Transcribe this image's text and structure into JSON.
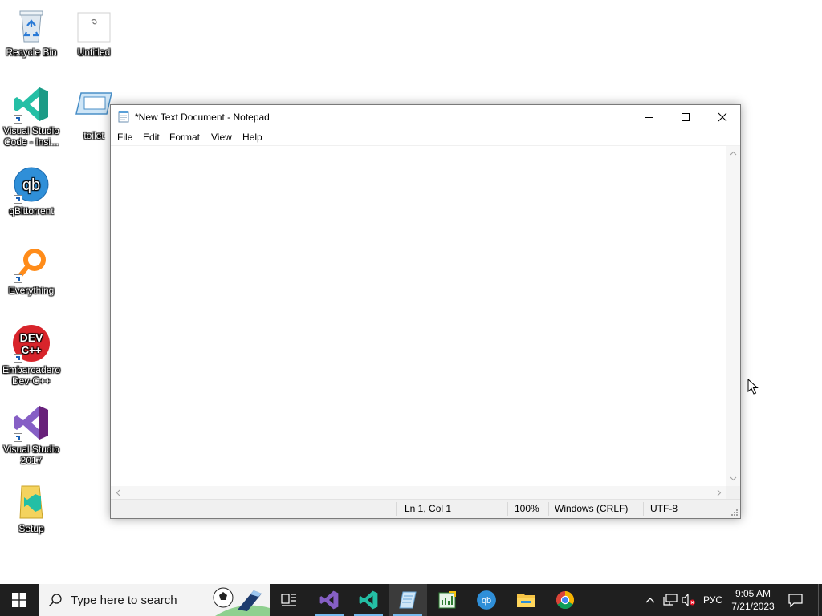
{
  "desktop": {
    "icons": [
      {
        "label": "Recycle Bin"
      },
      {
        "label": "Untitled"
      },
      {
        "label": "Visual Studio Code - Insi..."
      },
      {
        "label": "toilet"
      },
      {
        "label": "qBittorrent"
      },
      {
        "label": "Everything"
      },
      {
        "label": "Embarcadero Dev-C++"
      },
      {
        "label": "Visual Studio 2017"
      },
      {
        "label": "Setup"
      }
    ]
  },
  "notepad": {
    "title": "*New Text Document - Notepad",
    "menu": [
      "File",
      "Edit",
      "Format",
      "View",
      "Help"
    ],
    "content": "",
    "status": {
      "position": "Ln 1, Col 1",
      "zoom": "100%",
      "line_endings": "Windows (CRLF)",
      "encoding": "UTF-8"
    }
  },
  "taskbar": {
    "search_placeholder": "Type here to search",
    "apps": [
      {
        "icon": "task-view-icon"
      },
      {
        "icon": "visual-studio-icon"
      },
      {
        "icon": "vscode-icon"
      },
      {
        "icon": "notepad-icon",
        "active": true
      },
      {
        "icon": "spreadsheet-icon"
      },
      {
        "icon": "qbittorrent-icon"
      },
      {
        "icon": "file-explorer-icon"
      },
      {
        "icon": "chrome-icon"
      }
    ],
    "language": "РУС",
    "time": "9:05 AM",
    "date": "7/21/2023"
  },
  "colors": {
    "taskbar_bg": "#1f1f1f",
    "accent": "#76b9ed",
    "vscode_blue": "#23a9f2",
    "vs_purple": "#865fc5"
  }
}
